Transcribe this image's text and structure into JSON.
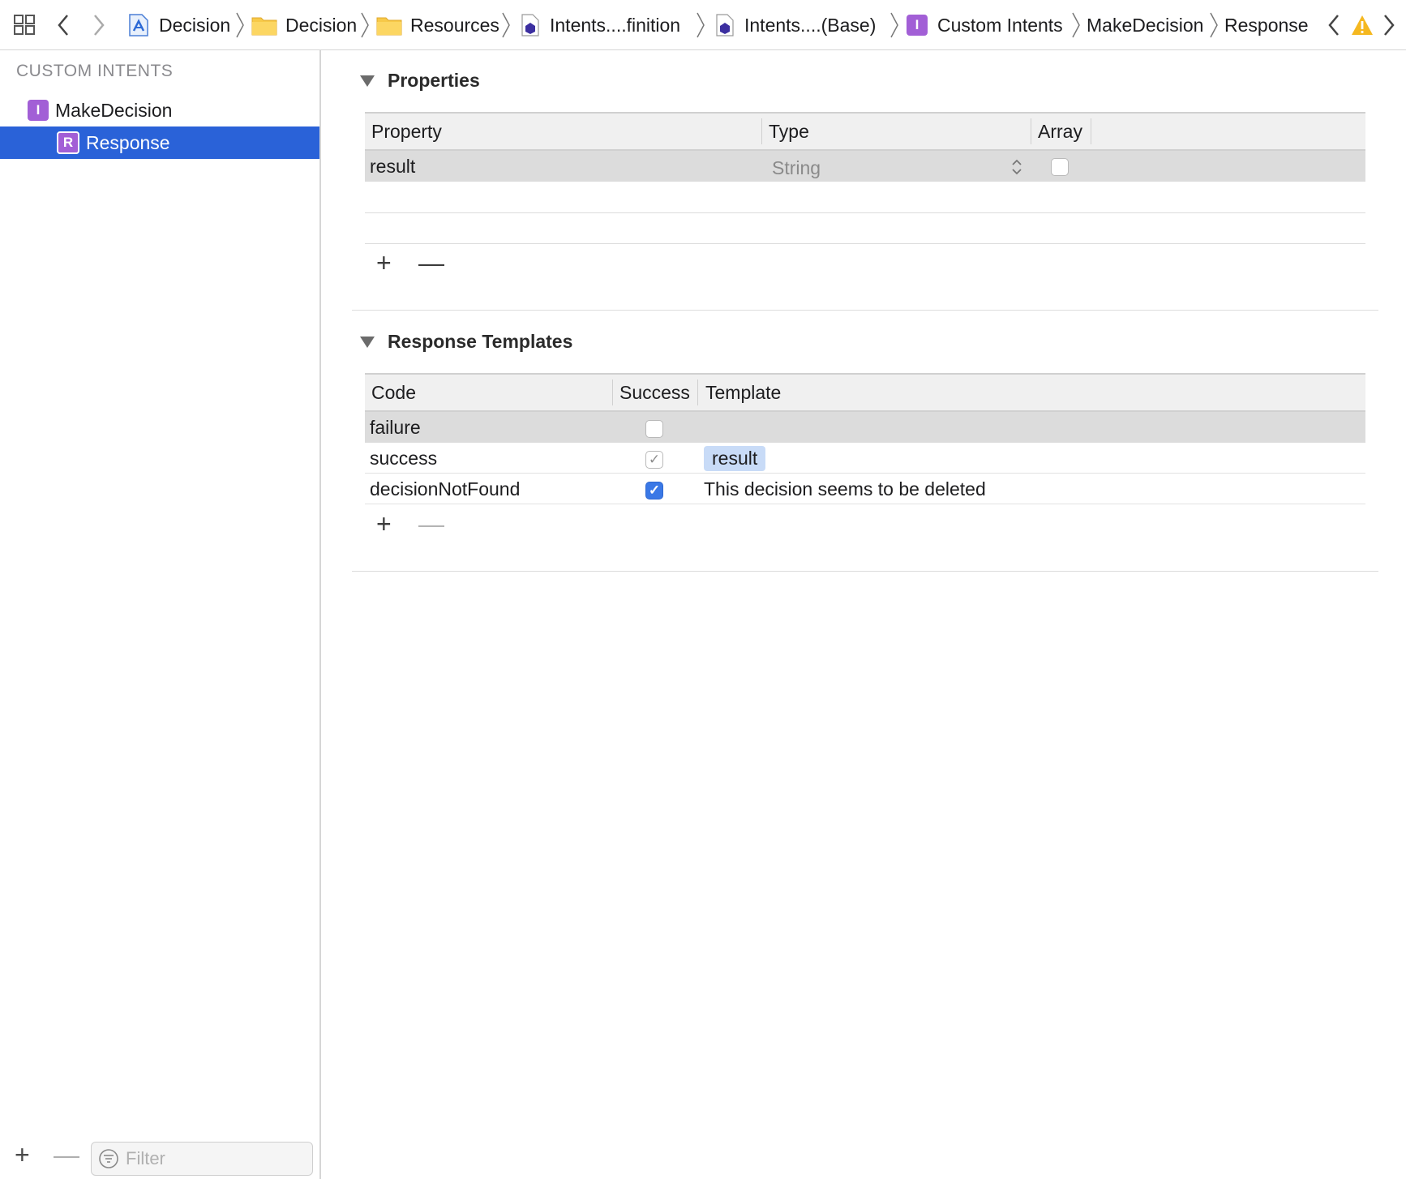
{
  "jumpbar": {
    "crumbs": [
      {
        "label": "Decision",
        "icon": "xcode-project-icon"
      },
      {
        "label": "Decision",
        "icon": "folder-icon"
      },
      {
        "label": "Resources",
        "icon": "folder-icon"
      },
      {
        "label": "Intents....finition",
        "icon": "intent-definition-file-icon"
      },
      {
        "label": "Intents....(Base)",
        "icon": "intent-definition-file-icon"
      },
      {
        "label": "Custom Intents",
        "icon": "intent-badge-icon"
      },
      {
        "label": "MakeDecision"
      },
      {
        "label": "Response"
      }
    ],
    "intent_badge_letter": "I",
    "warning_color": "#f5b820"
  },
  "sidebar": {
    "header": "CUSTOM INTENTS",
    "items": [
      {
        "label": "MakeDecision",
        "badge": "I"
      },
      {
        "label": "Response",
        "badge": "R",
        "selected": true
      }
    ],
    "add_label": "+",
    "remove_label": "—",
    "filter_placeholder": "Filter",
    "selection_color": "#2a62d8",
    "badge_color": "#a25fd6"
  },
  "properties": {
    "title": "Properties",
    "columns": [
      "Property",
      "Type",
      "Array"
    ],
    "rows": [
      {
        "property": "result",
        "type": "String",
        "array": false
      }
    ],
    "add_label": "+",
    "remove_label": "—"
  },
  "response_templates": {
    "title": "Response Templates",
    "columns": [
      "Code",
      "Success",
      "Template"
    ],
    "rows": [
      {
        "code": "failure",
        "success": false,
        "template": ""
      },
      {
        "code": "success",
        "success": true,
        "template_token": "result"
      },
      {
        "code": "decisionNotFound",
        "success": true,
        "template": "This decision seems to be deleted"
      }
    ],
    "add_label": "+",
    "remove_label": "—"
  }
}
